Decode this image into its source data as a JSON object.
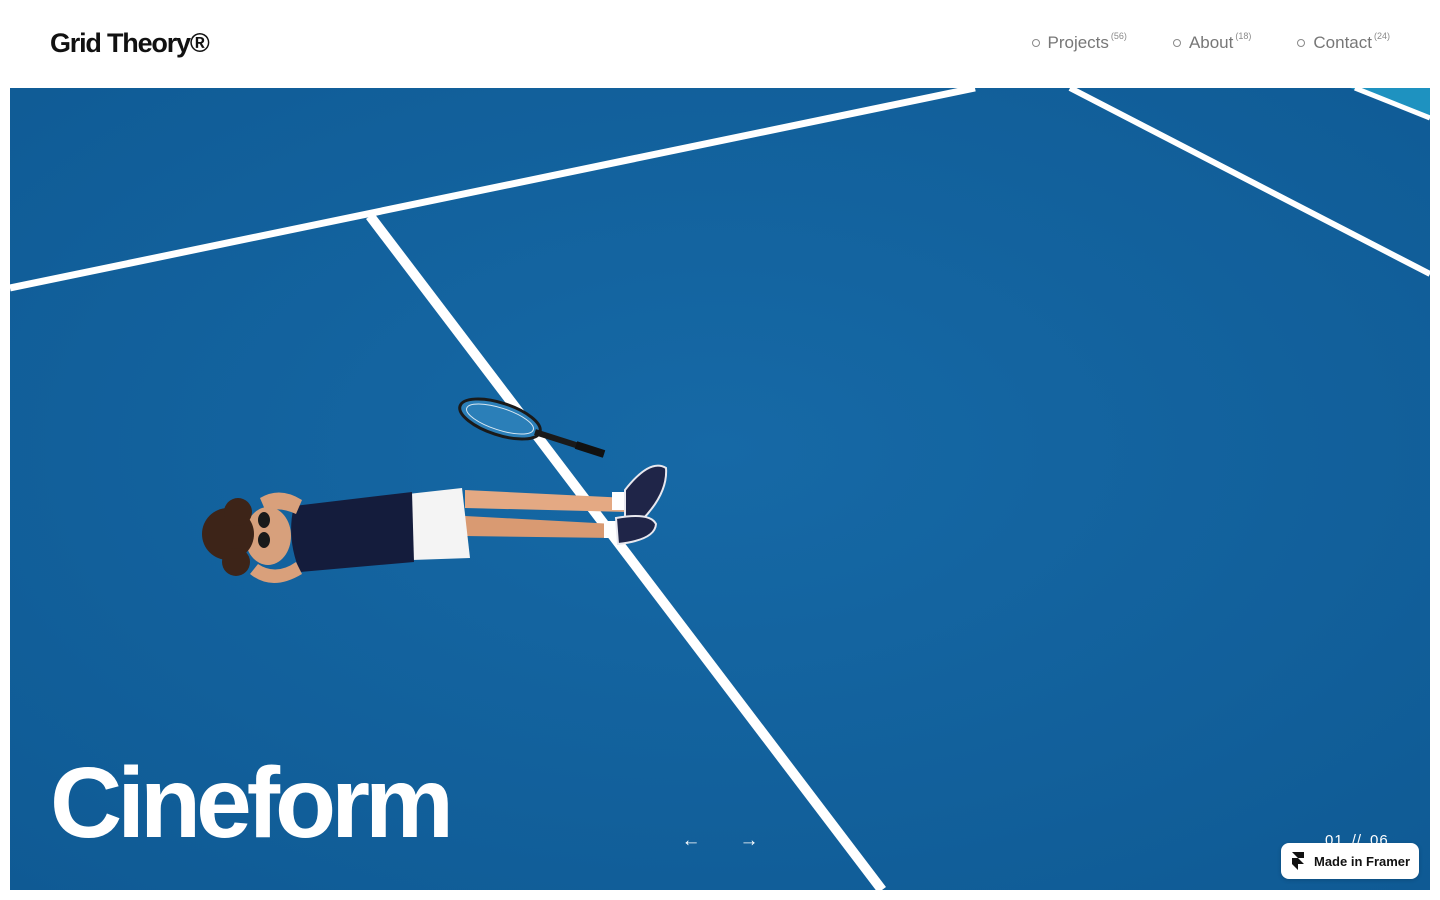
{
  "header": {
    "logo": "Grid Theory®",
    "nav": [
      {
        "label": "Projects",
        "count": "(56)"
      },
      {
        "label": "About",
        "count": "(18)"
      },
      {
        "label": "Contact",
        "count": "(24)"
      }
    ]
  },
  "hero": {
    "project_title": "Cineform",
    "prev_icon": "arrow-left-icon",
    "next_icon": "arrow-right-icon",
    "counter": {
      "current": "01",
      "separator": "//",
      "total": "06"
    },
    "court_color": "#125f9a"
  },
  "badge": {
    "label": "Made in Framer",
    "icon": "framer-icon"
  }
}
